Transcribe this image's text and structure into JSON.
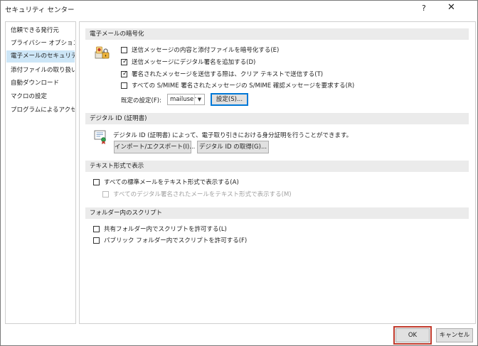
{
  "window": {
    "title": "セキュリティ センター",
    "help": "?",
    "close": "✕"
  },
  "sidebar": {
    "items": [
      {
        "label": "信頼できる発行元"
      },
      {
        "label": "プライバシー オプション"
      },
      {
        "label": "電子メールのセキュリティ",
        "selected": true
      },
      {
        "label": "添付ファイルの取り扱い"
      },
      {
        "label": "自動ダウンロード"
      },
      {
        "label": "マクロの設定"
      },
      {
        "label": "プログラムによるアクセス"
      }
    ]
  },
  "encryption": {
    "header": "電子メールの暗号化",
    "options": [
      {
        "label": "送信メッセージの内容と添付ファイルを暗号化する(E)",
        "checked": false
      },
      {
        "label": "送信メッセージにデジタル署名を追加する(D)",
        "checked": true
      },
      {
        "label": "署名されたメッセージを送信する際は、クリア テキストで送信する(T)",
        "checked": true
      },
      {
        "label": "すべての S/MIME 署名されたメッセージの S/MIME 確認メッセージを要求する(R)",
        "checked": false
      }
    ],
    "default_label": "既定の設定(F):",
    "default_value": "mailuser",
    "settings_button": "設定(S)..."
  },
  "digital_id": {
    "header": "デジタル ID (証明書)",
    "description": "デジタル ID (証明書) によって、電子取り引きにおける身分証明を行うことができます。",
    "import_export_button": "インポート/エクスポート(I)...",
    "get_id_button": "デジタル ID の取得(G)..."
  },
  "plain_text": {
    "header": "テキスト形式で表示",
    "read_all_plain": {
      "label": "すべての標準メールをテキスト形式で表示する(A)",
      "checked": false
    },
    "read_signed_plain": {
      "label": "すべてのデジタル署名されたメールをテキスト形式で表示する(M)",
      "checked": false,
      "disabled": true
    }
  },
  "folder_script": {
    "header": "フォルダー内のスクリプト",
    "shared": {
      "label": "共有フォルダー内でスクリプトを許可する(L)",
      "checked": false
    },
    "public": {
      "label": "パブリック フォルダー内でスクリプトを許可する(F)",
      "checked": false
    }
  },
  "footer": {
    "ok": "OK",
    "cancel": "キャンセル"
  }
}
